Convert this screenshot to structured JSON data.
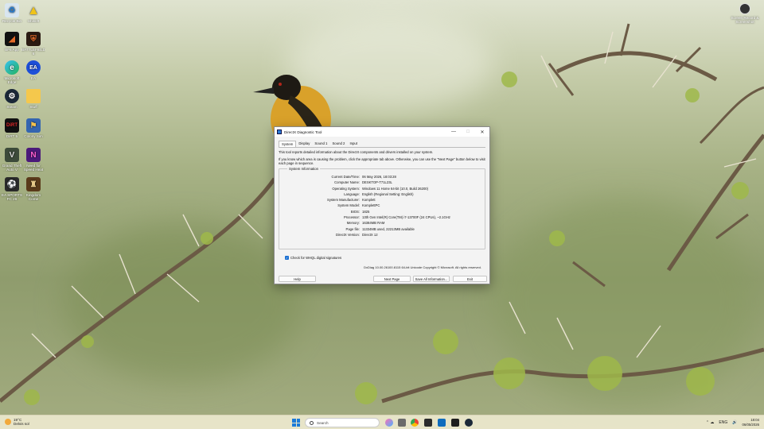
{
  "desktop": {
    "icons": [
      {
        "label": "Recycle Bin"
      },
      {
        "label": "Ubisoft"
      },
      {
        "label": "BF6 App"
      },
      {
        "label": "BATTLEFIELD 6"
      },
      {
        "label": "Microsoft Edge"
      },
      {
        "label": "EA"
      },
      {
        "label": "Steam"
      },
      {
        "label": "Stuff"
      },
      {
        "label": "DiRT 5"
      },
      {
        "label": "Colony Sim"
      },
      {
        "label": "Grand Theft Auto V Enhanced"
      },
      {
        "label": "Need for Speed Heat"
      },
      {
        "label": "EA SPORTS FC 26"
      },
      {
        "label": "Kingdom Come"
      }
    ],
    "top_right_icon": {
      "label": "Screen Record & Screenshot"
    }
  },
  "window": {
    "title": "DirectX Diagnostic Tool",
    "controls": {
      "minimize": "—",
      "maximize": "□",
      "close": "✕"
    },
    "tabs": [
      "System",
      "Display",
      "Sound 1",
      "Sound 2",
      "Input"
    ],
    "active_tab": "System",
    "intro_1": "This tool reports detailed information about the DirectX components and drivers installed on your system.",
    "intro_2": "If you know which area is causing the problem, click the appropriate tab above. Otherwise, you can use the \"Next Page\" button below to visit each page in sequence.",
    "section_title": "System Information",
    "info": [
      {
        "key": "Current Date/Time:",
        "value": "06 May 2026, 18:03:28"
      },
      {
        "key": "Computer Name:",
        "value": "DESKTOP-T71L23L"
      },
      {
        "key": "Operating System:",
        "value": "Windows 11 Home 64-bit (10.0, Build 26200)"
      },
      {
        "key": "Language:",
        "value": "English (Regional Setting: English)"
      },
      {
        "key": "System Manufacturer:",
        "value": "Komplett"
      },
      {
        "key": "System Model:",
        "value": "KomplettPC"
      },
      {
        "key": "BIOS:",
        "value": "1825"
      },
      {
        "key": "Processor:",
        "value": "13th Gen Intel(R) Core(TM) i7-13700F (24 CPUs), ~2.1GHz"
      },
      {
        "key": "Memory:",
        "value": "16384MB RAM"
      },
      {
        "key": "Page file:",
        "value": "11334MB used, 22213MB available"
      },
      {
        "key": "DirectX Version:",
        "value": "DirectX 12"
      }
    ],
    "checkbox_label": "Check for WHQL digital signatures",
    "checkbox_checked": true,
    "copyright": "DxDiag 10.00.26100.8115 64-bit Unicode  Copyright © Microsoft. All rights reserved.",
    "buttons": {
      "help": "Help",
      "next": "Next Page",
      "save": "Save All Information...",
      "exit": "Exit"
    }
  },
  "taskbar": {
    "weather_temp": "19°C",
    "weather_desc": "Delvis sol",
    "search_placeholder": "Search",
    "tray_lang": "ENG",
    "tray_symbols": "⌃  ☁",
    "time": "18:04",
    "date": "06/05/2026"
  }
}
